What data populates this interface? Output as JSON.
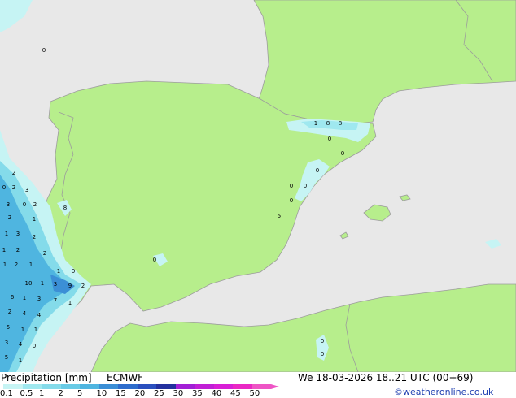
{
  "title": "Precipitation [mm]",
  "model": "ECMWF",
  "valid_time": "We 18-03-2026 18..21 UTC (00+69)",
  "credit": "©weatheronline.co.uk",
  "colors": {
    "sea": "#e8e8e8",
    "land": "#b7ee8c",
    "border": "#9c9c9c"
  },
  "legend": {
    "ticks": [
      "0.1",
      "0.5",
      "1",
      "2",
      "5",
      "10",
      "15",
      "20",
      "25",
      "30",
      "35",
      "40",
      "45",
      "50"
    ],
    "colors": [
      "#c6f4f4",
      "#9fe8ef",
      "#84dbea",
      "#69cbe6",
      "#4fb5e0",
      "#3b8fd6",
      "#2e6dcc",
      "#2a4fbe",
      "#23309e",
      "#a21fd6",
      "#c11fd6",
      "#d81fd6",
      "#ea28c4",
      "#ee55c5"
    ]
  },
  "map_values": [
    "2",
    "1",
    "8",
    "8",
    "0",
    "0",
    "0",
    "0",
    "0",
    "0",
    "5",
    "0",
    "2",
    "3",
    "3",
    "0",
    "2",
    "2",
    "1",
    "8",
    "1",
    "3",
    "2",
    "1",
    "2",
    "2",
    "1",
    "2",
    "1",
    "1",
    "0",
    "10",
    "1",
    "3",
    "9",
    "2",
    "6",
    "1",
    "3",
    "7",
    "1",
    "2",
    "4",
    "4",
    "5",
    "1",
    "1",
    "3",
    "4",
    "0",
    "5",
    "1",
    "0",
    "0",
    "0",
    "0"
  ]
}
